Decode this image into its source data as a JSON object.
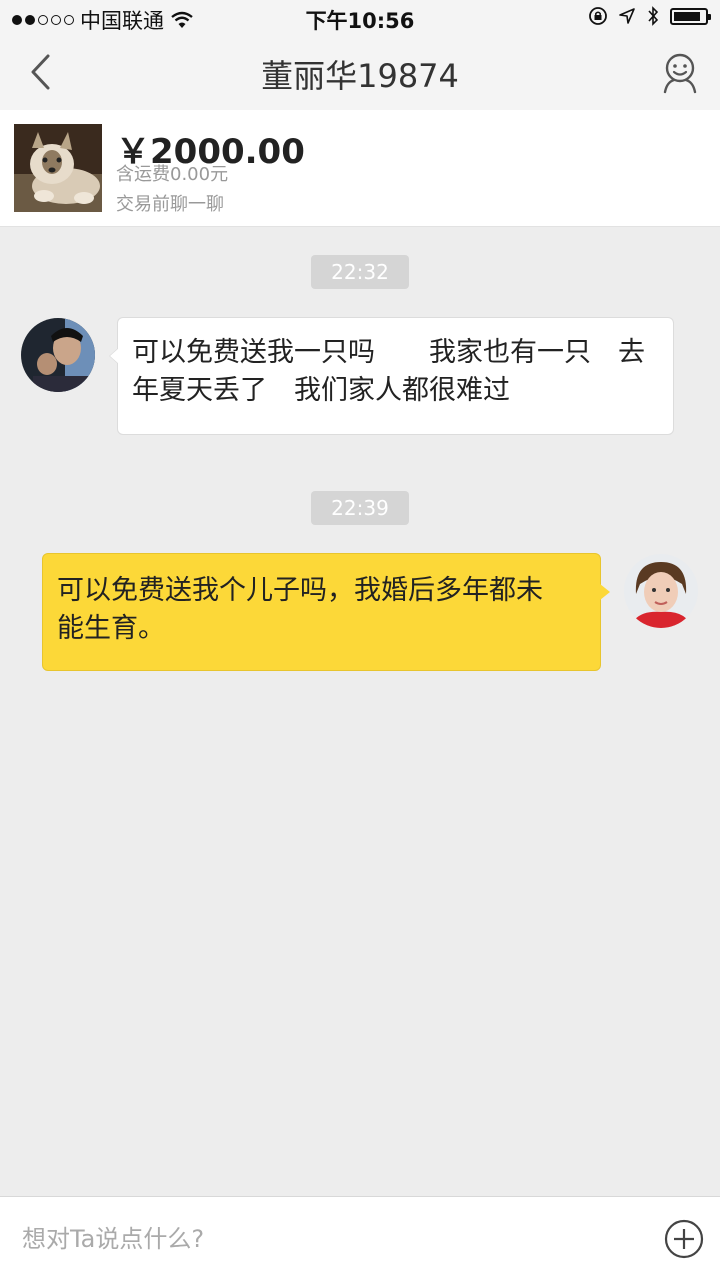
{
  "status_bar": {
    "carrier": "中国联通",
    "time": "下午10:56",
    "signal_bars_filled": 2,
    "signal_bars_total": 5,
    "battery_level": 0.85,
    "icons": [
      "wifi-icon",
      "orientation-lock-icon",
      "location-icon",
      "bluetooth-icon",
      "battery-icon"
    ]
  },
  "nav": {
    "title": "董丽华19874",
    "back_icon": "chevron-left-icon",
    "profile_icon": "user-icon"
  },
  "item": {
    "price": "￥2000.00",
    "shipping": "含运费0.00元",
    "note": "交易前聊一聊"
  },
  "messages": [
    {
      "time": "22:32",
      "side": "left",
      "line1": "可以免费送我一只吗　　我家也有一只　去",
      "line2": "年夏天丢了　我们家人都很难过"
    },
    {
      "time": "22:39",
      "side": "right",
      "line1": "可以免费送我个儿子吗，我婚后多年都未",
      "line2": "能生育。"
    }
  ],
  "input": {
    "placeholder": "想对Ta说点什么?",
    "value": "",
    "plus_icon": "plus-circle-icon"
  },
  "colors": {
    "own_bubble": "#fcd838",
    "other_bubble": "#ffffff",
    "background": "#ededed",
    "time_chip": "#d5d5d5"
  }
}
